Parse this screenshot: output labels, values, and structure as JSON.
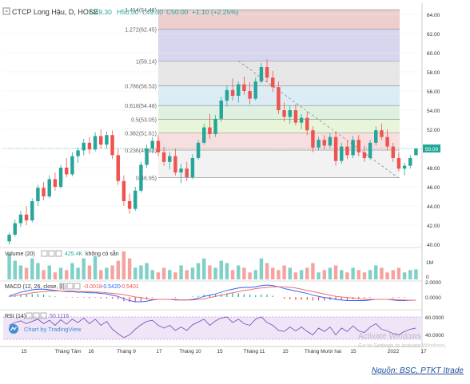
{
  "header": {
    "symbol": "CTCP Long Hậu, D, HOSE",
    "open": "O49.30",
    "high": "H50.00",
    "low": "L49.30",
    "close": "C50.00",
    "change": "+1.10 (+2.25%)"
  },
  "fib_labels": [
    {
      "label": "1.414(64.48)",
      "ratio": 1.414,
      "price": 64.48
    },
    {
      "label": "1.272(62.45)",
      "ratio": 1.272,
      "price": 62.45
    },
    {
      "label": "1(59.14)",
      "ratio": 1,
      "price": 59.14
    },
    {
      "label": "0.786(56.53)",
      "ratio": 0.786,
      "price": 56.53
    },
    {
      "label": "0.618(54.48)",
      "ratio": 0.618,
      "price": 54.48
    },
    {
      "label": "0.5(53.05)",
      "ratio": 0.5,
      "price": 53.05
    },
    {
      "label": "0.382(51.61)",
      "ratio": 0.382,
      "price": 51.61
    },
    {
      "label": "0.236(49.83)",
      "ratio": 0.236,
      "price": 49.83
    },
    {
      "label": "0(46.95)",
      "ratio": 0,
      "price": 46.95
    }
  ],
  "fib_colors": [
    "#e8bcbc",
    "#c8c8ea",
    "#dddddd",
    "#cfe6f2",
    "#d3ecd7",
    "#e2f1cb",
    "#f5d4d4"
  ],
  "price_axis": [
    "64.00",
    "62.00",
    "60.00",
    "58.00",
    "56.00",
    "54.00",
    "52.00",
    "50.00",
    "48.00",
    "46.00",
    "44.00",
    "42.00",
    "40.00"
  ],
  "last_price": "50.00",
  "volume_pane": {
    "label": "Volume (20)",
    "value": "425.4K",
    "extra": "không có sẵn",
    "axis_top": "1M",
    "axis_bottom": "0"
  },
  "macd_pane": {
    "label": "MACD (12, 26, close, 9)",
    "v1": "-0.0018",
    "v2": "-0.5420",
    "v3": "-0.5401",
    "axis": [
      "2.0000",
      "0.0000"
    ]
  },
  "rsi_pane": {
    "label": "RSI (14)",
    "value": "50.1116",
    "axis": [
      "60.0000",
      "40.0000"
    ]
  },
  "chart_by": "Chart by TradingView",
  "date_axis": [
    "15",
    "Tháng Tám",
    "16",
    "Tháng 9",
    "17",
    "Tháng 10",
    "15",
    "Tháng 11",
    "15",
    "Tháng Mười hai",
    "15",
    "2022",
    "17"
  ],
  "watermark": {
    "line1": "Activate Windows",
    "line2": "Go to Settings to activate Windows."
  },
  "source": "Nguồn: BSC, PTKT Itrade",
  "colors": {
    "up": "#26a69a",
    "down": "#ef5350",
    "macd": "#2962ff",
    "signal": "#ef6c6c",
    "rsi": "#7e57c2"
  },
  "chart_data": {
    "type": "candlestick",
    "title": "CTCP Long Hậu, D, HOSE",
    "ylim": [
      40,
      65
    ],
    "candles": [
      [
        40.3,
        41.2,
        40.0,
        41.0
      ],
      [
        41.0,
        42.6,
        40.8,
        42.2
      ],
      [
        42.2,
        43.5,
        41.8,
        43.1
      ],
      [
        43.1,
        44.0,
        42.0,
        42.5
      ],
      [
        42.5,
        44.8,
        42.3,
        44.5
      ],
      [
        44.5,
        46.2,
        44.0,
        45.9
      ],
      [
        45.9,
        46.5,
        44.6,
        45.0
      ],
      [
        45.0,
        47.2,
        44.8,
        46.8
      ],
      [
        46.8,
        47.5,
        45.6,
        46.0
      ],
      [
        46.0,
        48.3,
        45.8,
        48.0
      ],
      [
        48.0,
        49.0,
        47.0,
        47.3
      ],
      [
        47.3,
        49.6,
        47.1,
        49.2
      ],
      [
        49.2,
        50.1,
        48.5,
        49.8
      ],
      [
        49.8,
        51.0,
        49.3,
        50.6
      ],
      [
        50.6,
        51.2,
        49.4,
        49.9
      ],
      [
        49.9,
        51.7,
        49.7,
        51.3
      ],
      [
        51.3,
        52.0,
        50.0,
        50.4
      ],
      [
        50.4,
        51.8,
        50.0,
        51.4
      ],
      [
        51.4,
        51.9,
        48.9,
        49.3
      ],
      [
        49.3,
        50.0,
        46.2,
        46.6
      ],
      [
        46.6,
        47.2,
        44.0,
        44.5
      ],
      [
        44.5,
        45.3,
        43.2,
        43.7
      ],
      [
        43.7,
        46.0,
        43.5,
        45.6
      ],
      [
        45.6,
        48.6,
        45.4,
        48.3
      ],
      [
        48.3,
        50.4,
        48.0,
        50.0
      ],
      [
        50.0,
        51.2,
        49.5,
        50.8
      ],
      [
        50.8,
        51.4,
        49.2,
        49.6
      ],
      [
        49.6,
        50.2,
        48.2,
        48.6
      ],
      [
        48.6,
        49.6,
        47.8,
        49.2
      ],
      [
        49.2,
        50.0,
        47.2,
        47.5
      ],
      [
        47.5,
        48.4,
        46.4,
        47.9
      ],
      [
        47.9,
        48.6,
        46.6,
        47.0
      ],
      [
        47.0,
        49.4,
        46.8,
        49.0
      ],
      [
        49.0,
        50.9,
        48.8,
        50.6
      ],
      [
        50.6,
        52.6,
        50.4,
        52.2
      ],
      [
        52.2,
        53.6,
        51.0,
        51.5
      ],
      [
        51.5,
        53.5,
        51.2,
        53.1
      ],
      [
        53.1,
        55.4,
        52.8,
        55.0
      ],
      [
        55.0,
        56.6,
        54.4,
        56.1
      ],
      [
        56.1,
        57.3,
        55.0,
        55.5
      ],
      [
        55.5,
        57.0,
        54.8,
        56.7
      ],
      [
        56.7,
        57.5,
        55.6,
        56.0
      ],
      [
        56.0,
        56.9,
        54.6,
        55.2
      ],
      [
        55.2,
        57.4,
        55.0,
        57.0
      ],
      [
        57.0,
        58.9,
        56.8,
        58.5
      ],
      [
        58.5,
        59.3,
        56.9,
        57.4
      ],
      [
        57.4,
        58.1,
        55.9,
        56.4
      ],
      [
        56.4,
        57.0,
        53.6,
        54.0
      ],
      [
        54.0,
        54.8,
        52.8,
        53.3
      ],
      [
        53.3,
        54.5,
        52.6,
        54.0
      ],
      [
        54.0,
        54.6,
        52.4,
        52.7
      ],
      [
        52.7,
        53.6,
        52.0,
        53.2
      ],
      [
        53.2,
        53.9,
        51.4,
        51.9
      ],
      [
        51.9,
        52.3,
        49.6,
        50.1
      ],
      [
        50.1,
        51.2,
        49.8,
        50.9
      ],
      [
        50.9,
        51.4,
        49.9,
        50.3
      ],
      [
        50.3,
        51.6,
        50.0,
        51.2
      ],
      [
        51.2,
        51.8,
        48.2,
        48.7
      ],
      [
        48.7,
        50.6,
        48.4,
        50.2
      ],
      [
        50.2,
        50.8,
        48.9,
        49.3
      ],
      [
        49.3,
        51.3,
        49.0,
        50.9
      ],
      [
        50.9,
        51.4,
        49.2,
        49.6
      ],
      [
        49.6,
        50.3,
        48.6,
        49.0
      ],
      [
        49.0,
        50.9,
        48.8,
        50.6
      ],
      [
        50.6,
        52.3,
        50.3,
        51.9
      ],
      [
        51.9,
        52.6,
        50.9,
        51.2
      ],
      [
        51.2,
        52.0,
        49.8,
        50.2
      ],
      [
        50.2,
        50.6,
        48.6,
        49.0
      ],
      [
        49.0,
        49.6,
        47.6,
        47.9
      ],
      [
        47.9,
        48.5,
        47.2,
        48.2
      ],
      [
        48.2,
        49.3,
        47.9,
        49.0
      ],
      [
        49.3,
        50.0,
        49.3,
        50.0
      ]
    ],
    "volume": [
      1.1,
      0.8,
      0.6,
      0.5,
      0.9,
      0.7,
      0.4,
      0.6,
      0.3,
      0.5,
      0.4,
      0.7,
      0.5,
      0.9,
      0.6,
      1.0,
      0.4,
      0.5,
      0.6,
      0.8,
      1.2,
      0.9,
      0.5,
      0.6,
      0.7,
      0.4,
      0.3,
      0.5,
      0.4,
      0.3,
      0.6,
      0.4,
      0.5,
      0.7,
      0.9,
      0.6,
      0.5,
      0.8,
      0.7,
      0.4,
      0.6,
      0.5,
      0.3,
      0.4,
      0.9,
      0.7,
      0.5,
      0.4,
      0.6,
      0.5,
      0.3,
      0.4,
      0.5,
      0.7,
      0.3,
      0.4,
      0.5,
      0.6,
      0.4,
      0.3,
      0.5,
      0.4,
      0.3,
      0.4,
      0.6,
      0.5,
      0.3,
      0.4,
      0.5,
      0.3,
      0.4,
      0.43
    ],
    "macd": [
      0.2,
      0.5,
      0.8,
      1.0,
      1.2,
      1.3,
      1.3,
      1.2,
      1.1,
      1.0,
      0.9,
      0.9,
      0.8,
      0.8,
      0.7,
      0.7,
      0.6,
      0.5,
      0.3,
      0.1,
      -0.3,
      -0.6,
      -0.8,
      -0.8,
      -0.7,
      -0.5,
      -0.4,
      -0.4,
      -0.4,
      -0.5,
      -0.5,
      -0.5,
      -0.4,
      -0.2,
      0.1,
      0.3,
      0.5,
      0.8,
      1.1,
      1.3,
      1.5,
      1.6,
      1.6,
      1.7,
      1.9,
      2.0,
      1.9,
      1.7,
      1.4,
      1.2,
      1.0,
      0.8,
      0.6,
      0.3,
      0.1,
      -0.1,
      -0.2,
      -0.4,
      -0.5,
      -0.6,
      -0.6,
      -0.6,
      -0.6,
      -0.5,
      -0.4,
      -0.4,
      -0.4,
      -0.5,
      -0.6,
      -0.6,
      -0.55,
      -0.54
    ],
    "signal": [
      0.1,
      0.2,
      0.4,
      0.5,
      0.7,
      0.8,
      0.9,
      1.0,
      1.0,
      1.0,
      1.0,
      1.0,
      0.9,
      0.9,
      0.9,
      0.8,
      0.8,
      0.7,
      0.6,
      0.5,
      0.4,
      0.2,
      0.0,
      -0.1,
      -0.3,
      -0.4,
      -0.4,
      -0.4,
      -0.4,
      -0.4,
      -0.5,
      -0.5,
      -0.5,
      -0.4,
      -0.3,
      -0.1,
      0.1,
      0.3,
      0.5,
      0.7,
      0.9,
      1.1,
      1.2,
      1.4,
      1.5,
      1.6,
      1.7,
      1.7,
      1.7,
      1.6,
      1.5,
      1.3,
      1.1,
      0.9,
      0.7,
      0.5,
      0.3,
      0.1,
      0.0,
      -0.1,
      -0.2,
      -0.3,
      -0.4,
      -0.4,
      -0.4,
      -0.4,
      -0.4,
      -0.4,
      -0.5,
      -0.5,
      -0.55,
      -0.54
    ],
    "rsi": [
      55,
      60,
      63,
      58,
      62,
      66,
      58,
      64,
      55,
      65,
      57,
      66,
      60,
      68,
      58,
      66,
      55,
      62,
      48,
      40,
      33,
      38,
      48,
      56,
      62,
      64,
      55,
      50,
      55,
      46,
      52,
      46,
      56,
      61,
      66,
      55,
      63,
      68,
      70,
      60,
      66,
      58,
      55,
      66,
      70,
      60,
      55,
      46,
      44,
      52,
      45,
      52,
      44,
      38,
      50,
      44,
      52,
      38,
      50,
      44,
      54,
      45,
      42,
      52,
      58,
      48,
      45,
      40,
      38,
      44,
      48,
      50.1
    ]
  }
}
